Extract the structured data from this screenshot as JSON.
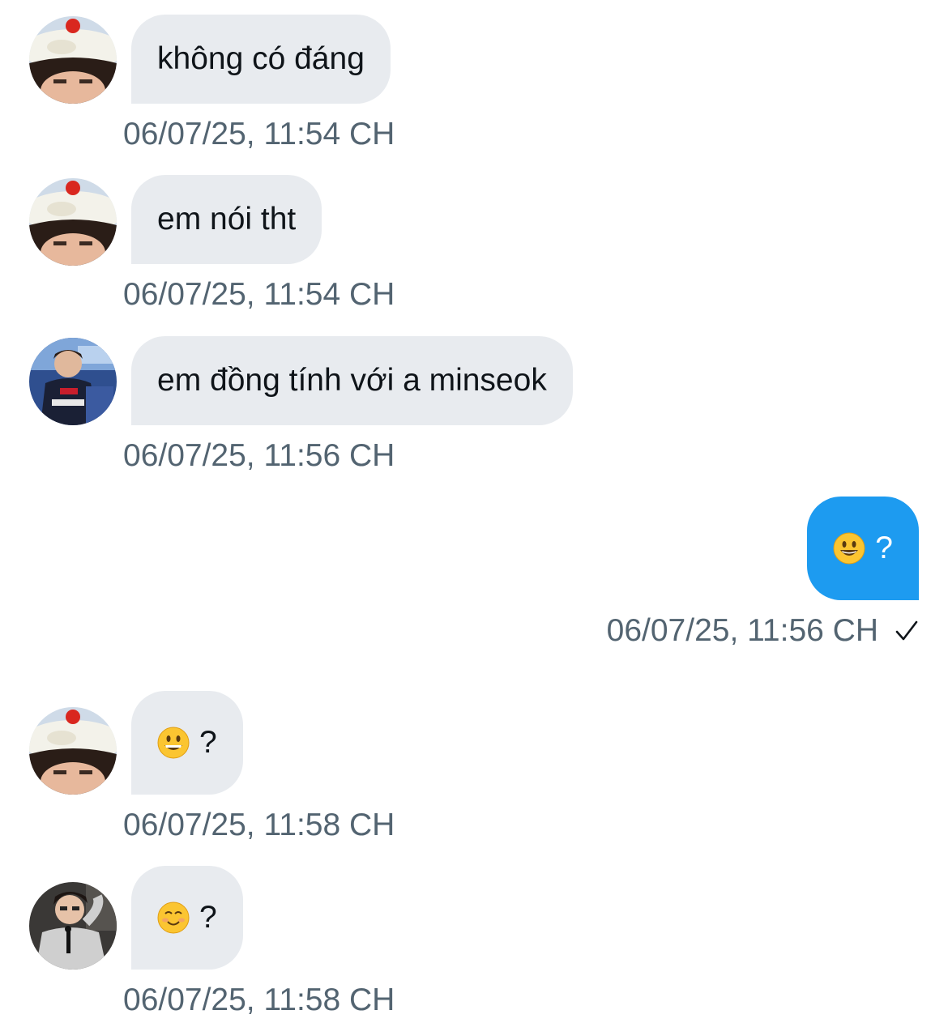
{
  "messages": [
    {
      "direction": "in",
      "avatar": "avatar-cream-hat",
      "text": "không có đáng",
      "timestamp": "06/07/25, 11:54 CH"
    },
    {
      "direction": "in",
      "avatar": "avatar-cream-hat",
      "text": "em nói tht",
      "timestamp": "06/07/25, 11:54 CH"
    },
    {
      "direction": "in",
      "avatar": "avatar-esports-player",
      "text": "em đồng tính với a minseok",
      "timestamp": "06/07/25, 11:56 CH"
    },
    {
      "direction": "out",
      "emoji": "smiley-face",
      "text": "?",
      "timestamp": "06/07/25, 11:56 CH",
      "status_icon": "check-icon"
    },
    {
      "direction": "in",
      "avatar": "avatar-cream-hat",
      "emoji": "grinning-face",
      "text": "?",
      "timestamp": "06/07/25, 11:58 CH"
    },
    {
      "direction": "in",
      "avatar": "avatar-player-microphone",
      "emoji": "smiling-face",
      "text": "?",
      "timestamp": "06/07/25, 11:58 CH"
    }
  ],
  "colors": {
    "incoming_bubble": "#e8ebef",
    "outgoing_bubble": "#1d9bf0",
    "timestamp": "#536471",
    "text": "#0f1419"
  }
}
